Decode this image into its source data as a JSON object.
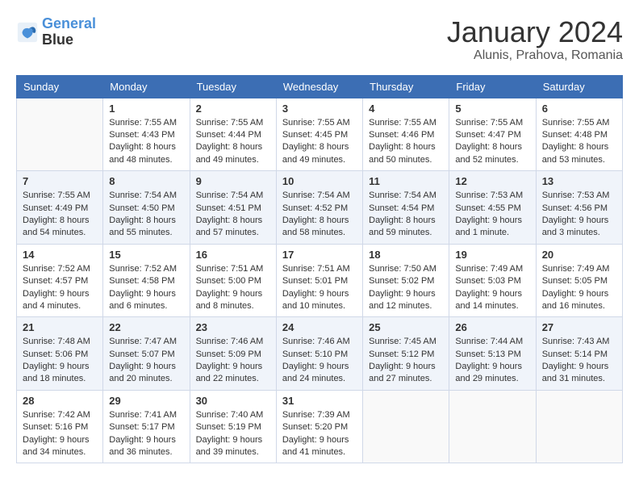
{
  "logo": {
    "line1": "General",
    "line2": "Blue"
  },
  "title": "January 2024",
  "location": "Alunis, Prahova, Romania",
  "days_of_week": [
    "Sunday",
    "Monday",
    "Tuesday",
    "Wednesday",
    "Thursday",
    "Friday",
    "Saturday"
  ],
  "weeks": [
    [
      {
        "day": "",
        "sunrise": "",
        "sunset": "",
        "daylight": ""
      },
      {
        "day": "1",
        "sunrise": "Sunrise: 7:55 AM",
        "sunset": "Sunset: 4:43 PM",
        "daylight": "Daylight: 8 hours and 48 minutes."
      },
      {
        "day": "2",
        "sunrise": "Sunrise: 7:55 AM",
        "sunset": "Sunset: 4:44 PM",
        "daylight": "Daylight: 8 hours and 49 minutes."
      },
      {
        "day": "3",
        "sunrise": "Sunrise: 7:55 AM",
        "sunset": "Sunset: 4:45 PM",
        "daylight": "Daylight: 8 hours and 49 minutes."
      },
      {
        "day": "4",
        "sunrise": "Sunrise: 7:55 AM",
        "sunset": "Sunset: 4:46 PM",
        "daylight": "Daylight: 8 hours and 50 minutes."
      },
      {
        "day": "5",
        "sunrise": "Sunrise: 7:55 AM",
        "sunset": "Sunset: 4:47 PM",
        "daylight": "Daylight: 8 hours and 52 minutes."
      },
      {
        "day": "6",
        "sunrise": "Sunrise: 7:55 AM",
        "sunset": "Sunset: 4:48 PM",
        "daylight": "Daylight: 8 hours and 53 minutes."
      }
    ],
    [
      {
        "day": "7",
        "sunrise": "Sunrise: 7:55 AM",
        "sunset": "Sunset: 4:49 PM",
        "daylight": "Daylight: 8 hours and 54 minutes."
      },
      {
        "day": "8",
        "sunrise": "Sunrise: 7:54 AM",
        "sunset": "Sunset: 4:50 PM",
        "daylight": "Daylight: 8 hours and 55 minutes."
      },
      {
        "day": "9",
        "sunrise": "Sunrise: 7:54 AM",
        "sunset": "Sunset: 4:51 PM",
        "daylight": "Daylight: 8 hours and 57 minutes."
      },
      {
        "day": "10",
        "sunrise": "Sunrise: 7:54 AM",
        "sunset": "Sunset: 4:52 PM",
        "daylight": "Daylight: 8 hours and 58 minutes."
      },
      {
        "day": "11",
        "sunrise": "Sunrise: 7:54 AM",
        "sunset": "Sunset: 4:54 PM",
        "daylight": "Daylight: 8 hours and 59 minutes."
      },
      {
        "day": "12",
        "sunrise": "Sunrise: 7:53 AM",
        "sunset": "Sunset: 4:55 PM",
        "daylight": "Daylight: 9 hours and 1 minute."
      },
      {
        "day": "13",
        "sunrise": "Sunrise: 7:53 AM",
        "sunset": "Sunset: 4:56 PM",
        "daylight": "Daylight: 9 hours and 3 minutes."
      }
    ],
    [
      {
        "day": "14",
        "sunrise": "Sunrise: 7:52 AM",
        "sunset": "Sunset: 4:57 PM",
        "daylight": "Daylight: 9 hours and 4 minutes."
      },
      {
        "day": "15",
        "sunrise": "Sunrise: 7:52 AM",
        "sunset": "Sunset: 4:58 PM",
        "daylight": "Daylight: 9 hours and 6 minutes."
      },
      {
        "day": "16",
        "sunrise": "Sunrise: 7:51 AM",
        "sunset": "Sunset: 5:00 PM",
        "daylight": "Daylight: 9 hours and 8 minutes."
      },
      {
        "day": "17",
        "sunrise": "Sunrise: 7:51 AM",
        "sunset": "Sunset: 5:01 PM",
        "daylight": "Daylight: 9 hours and 10 minutes."
      },
      {
        "day": "18",
        "sunrise": "Sunrise: 7:50 AM",
        "sunset": "Sunset: 5:02 PM",
        "daylight": "Daylight: 9 hours and 12 minutes."
      },
      {
        "day": "19",
        "sunrise": "Sunrise: 7:49 AM",
        "sunset": "Sunset: 5:03 PM",
        "daylight": "Daylight: 9 hours and 14 minutes."
      },
      {
        "day": "20",
        "sunrise": "Sunrise: 7:49 AM",
        "sunset": "Sunset: 5:05 PM",
        "daylight": "Daylight: 9 hours and 16 minutes."
      }
    ],
    [
      {
        "day": "21",
        "sunrise": "Sunrise: 7:48 AM",
        "sunset": "Sunset: 5:06 PM",
        "daylight": "Daylight: 9 hours and 18 minutes."
      },
      {
        "day": "22",
        "sunrise": "Sunrise: 7:47 AM",
        "sunset": "Sunset: 5:07 PM",
        "daylight": "Daylight: 9 hours and 20 minutes."
      },
      {
        "day": "23",
        "sunrise": "Sunrise: 7:46 AM",
        "sunset": "Sunset: 5:09 PM",
        "daylight": "Daylight: 9 hours and 22 minutes."
      },
      {
        "day": "24",
        "sunrise": "Sunrise: 7:46 AM",
        "sunset": "Sunset: 5:10 PM",
        "daylight": "Daylight: 9 hours and 24 minutes."
      },
      {
        "day": "25",
        "sunrise": "Sunrise: 7:45 AM",
        "sunset": "Sunset: 5:12 PM",
        "daylight": "Daylight: 9 hours and 27 minutes."
      },
      {
        "day": "26",
        "sunrise": "Sunrise: 7:44 AM",
        "sunset": "Sunset: 5:13 PM",
        "daylight": "Daylight: 9 hours and 29 minutes."
      },
      {
        "day": "27",
        "sunrise": "Sunrise: 7:43 AM",
        "sunset": "Sunset: 5:14 PM",
        "daylight": "Daylight: 9 hours and 31 minutes."
      }
    ],
    [
      {
        "day": "28",
        "sunrise": "Sunrise: 7:42 AM",
        "sunset": "Sunset: 5:16 PM",
        "daylight": "Daylight: 9 hours and 34 minutes."
      },
      {
        "day": "29",
        "sunrise": "Sunrise: 7:41 AM",
        "sunset": "Sunset: 5:17 PM",
        "daylight": "Daylight: 9 hours and 36 minutes."
      },
      {
        "day": "30",
        "sunrise": "Sunrise: 7:40 AM",
        "sunset": "Sunset: 5:19 PM",
        "daylight": "Daylight: 9 hours and 39 minutes."
      },
      {
        "day": "31",
        "sunrise": "Sunrise: 7:39 AM",
        "sunset": "Sunset: 5:20 PM",
        "daylight": "Daylight: 9 hours and 41 minutes."
      },
      {
        "day": "",
        "sunrise": "",
        "sunset": "",
        "daylight": ""
      },
      {
        "day": "",
        "sunrise": "",
        "sunset": "",
        "daylight": ""
      },
      {
        "day": "",
        "sunrise": "",
        "sunset": "",
        "daylight": ""
      }
    ]
  ]
}
